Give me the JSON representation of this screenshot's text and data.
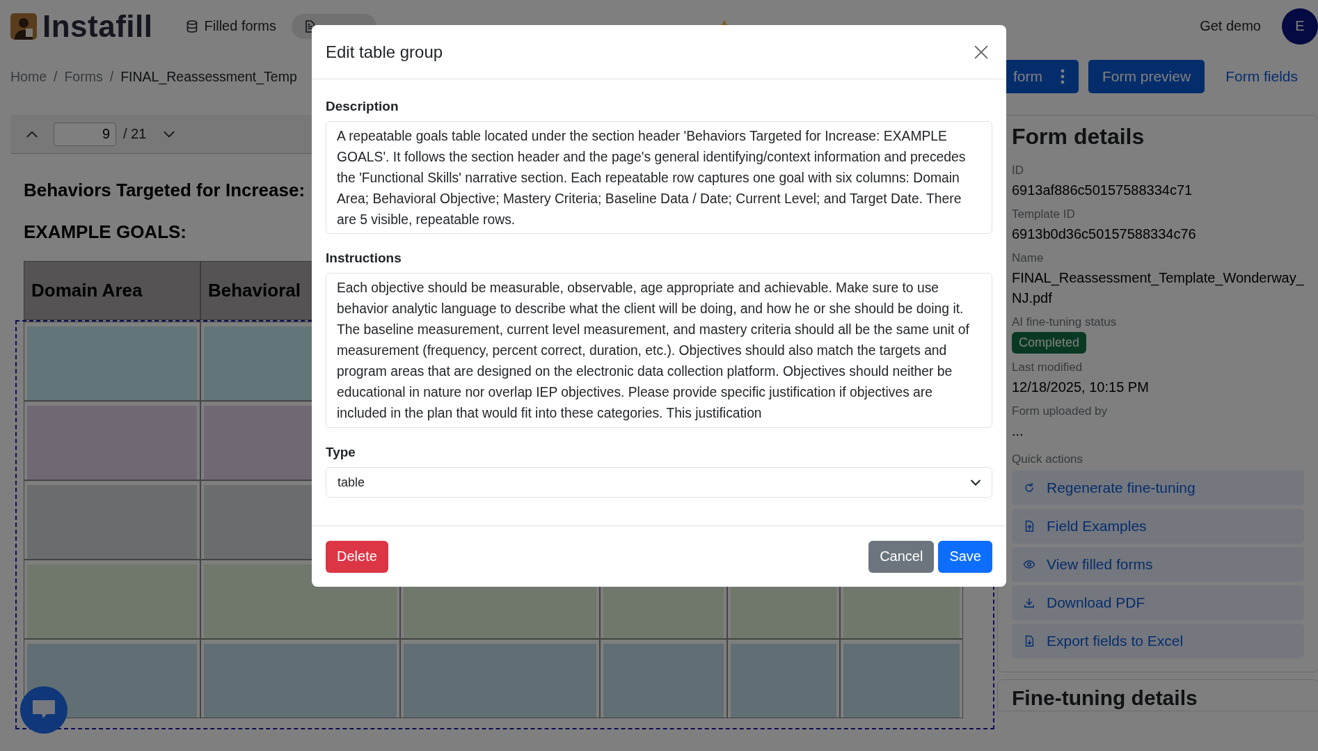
{
  "nav": {
    "brand": "Instafill",
    "items": [
      {
        "label": "Filled forms",
        "kind": "database",
        "selected": false
      },
      {
        "kind": "document",
        "selected": true
      },
      {
        "selected": false
      },
      {
        "selected": false
      },
      {
        "kind": "sparkle",
        "selected": false
      }
    ],
    "get_demo": "Get demo",
    "avatar": "E"
  },
  "breadcrumb": {
    "items": [
      "Home",
      "Forms",
      "FINAL_Reassessment_Temp"
    ],
    "separator": "/"
  },
  "actions": {
    "primary": "form",
    "preview": "Form preview",
    "fields": "Form fields"
  },
  "pager": {
    "page": "9",
    "total": "/ 21"
  },
  "pdf": {
    "heading": "Behaviors Targeted for Increase:",
    "subheading": "EXAMPLE GOALS:",
    "columns": [
      "Domain Area",
      "Behavioral"
    ]
  },
  "details": {
    "title": "Form details",
    "fields": [
      {
        "label": "ID",
        "value": "6913af886c50157588334c71",
        "kind": "text"
      },
      {
        "label": "Template ID",
        "value": "6913b0d36c50157588334c76",
        "kind": "text"
      },
      {
        "label": "Name",
        "value": "FINAL_Reassessment_Template_Wonderway_NJ.pdf",
        "kind": "text"
      },
      {
        "label": "AI fine-tuning status",
        "value": "Completed",
        "kind": "badge"
      },
      {
        "label": "Last modified",
        "value": "12/18/2025, 10:15 PM",
        "kind": "text"
      },
      {
        "label": "Form uploaded by",
        "value": "...",
        "kind": "text"
      }
    ],
    "quick_actions_label": "Quick actions",
    "quick_actions": [
      {
        "label": "Regenerate fine-tuning",
        "kind": "refresh"
      },
      {
        "label": "Field Examples",
        "kind": "file-up"
      },
      {
        "label": "View filled forms",
        "kind": "eye"
      },
      {
        "label": "Download PDF",
        "kind": "download"
      },
      {
        "label": "Export fields to Excel",
        "kind": "file-down"
      }
    ]
  },
  "fine_tuning_title": "Fine-tuning details",
  "modal": {
    "title": "Edit table group",
    "fields": [
      {
        "label": "Description",
        "kind": "textarea",
        "value": "A repeatable goals table located under the section header 'Behaviors Targeted for Increase: EXAMPLE GOALS'. It follows the section header and the page's general identifying/context information and precedes the 'Functional Skills' narrative section. Each repeatable row captures one goal with six columns: Domain Area; Behavioral Objective; Mastery Criteria; Baseline Data / Date; Current Level; and Target Date. There are 5 visible, repeatable rows."
      },
      {
        "label": "Instructions",
        "kind": "textarea",
        "value": "Each objective should be measurable, observable, age appropriate and achievable. Make sure to use behavior analytic language to describe what the client will be doing, and how he or she should be doing it. The baseline measurement, current level measurement, and mastery criteria should all be the same unit of measurement (frequency, percent correct, duration, etc.). Objectives should also match the targets and program areas that are designed on the electronic data collection platform. Objectives should neither be educational in nature nor overlap IEP objectives. Please provide specific justification if objectives are included in the plan that would fit into these categories. This justification"
      },
      {
        "label": "Type",
        "kind": "select",
        "value": "table"
      }
    ],
    "delete": "Delete",
    "cancel": "Cancel",
    "save": "Save"
  }
}
